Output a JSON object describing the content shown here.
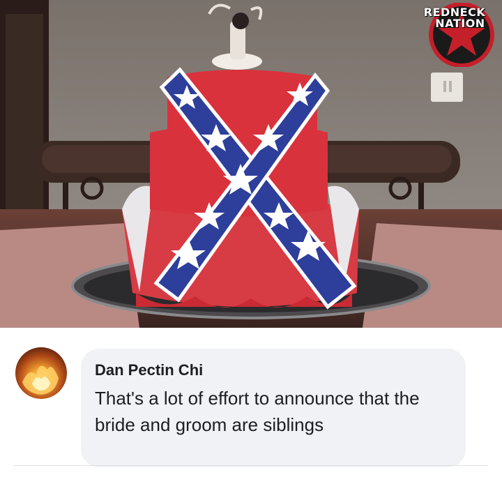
{
  "photo": {
    "watermark": {
      "line1": "REDNECK",
      "line2": "NATION"
    }
  },
  "comment": {
    "author": "Dan Pectin Chi",
    "text": "That's a lot of effort to announce that the bride and groom are siblings"
  }
}
